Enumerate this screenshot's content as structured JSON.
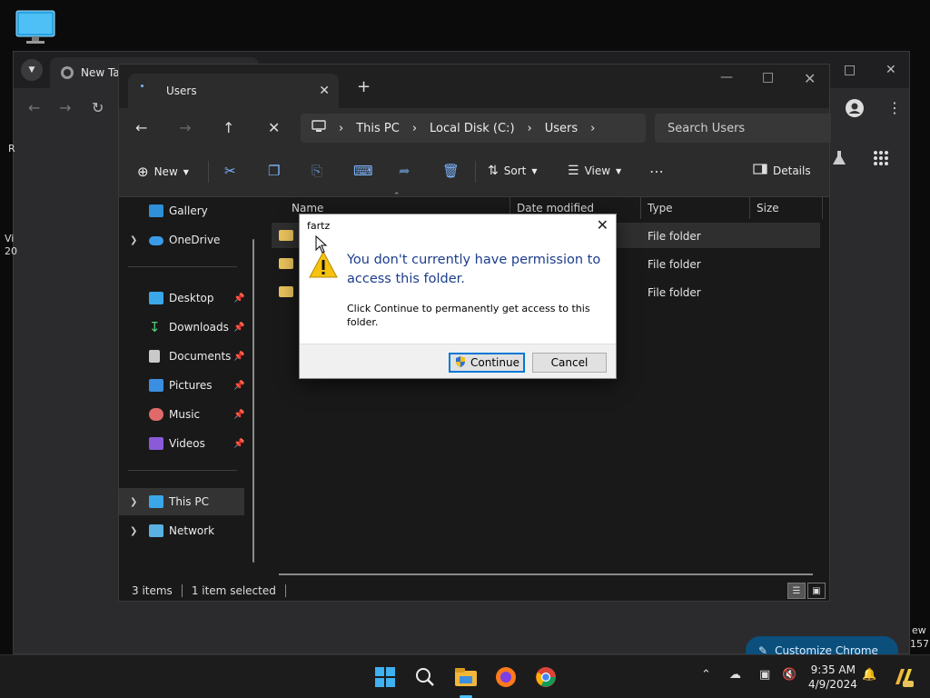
{
  "desktop": {
    "icon_name": "computer-monitor-icon"
  },
  "chrome": {
    "tab_title": "New Tab",
    "side_left_1": "R",
    "side_left_2": "Vi",
    "side_left_3": "20",
    "side_right_1": "ew",
    "side_right_2": "157",
    "customize_label": "Customize Chrome"
  },
  "explorer": {
    "tab_title": "Users",
    "breadcrumb": [
      "This PC",
      "Local Disk (C:)",
      "Users"
    ],
    "search_placeholder": "Search Users",
    "toolbar": {
      "new_label": "New",
      "sort_label": "Sort",
      "view_label": "View",
      "details_label": "Details"
    },
    "nav": {
      "gallery": "Gallery",
      "onedrive": "OneDrive",
      "desktop": "Desktop",
      "downloads": "Downloads",
      "documents": "Documents",
      "pictures": "Pictures",
      "music": "Music",
      "videos": "Videos",
      "thispc": "This PC",
      "network": "Network"
    },
    "columns": {
      "name": "Name",
      "date": "Date modified",
      "type": "Type",
      "size": "Size"
    },
    "rows": [
      {
        "type": "File folder"
      },
      {
        "type": "File folder"
      },
      {
        "type": "File folder"
      }
    ],
    "status": {
      "items": "3 items",
      "selected": "1 item selected"
    }
  },
  "dialog": {
    "title": "fartz",
    "heading": "You don't currently have permission to access this folder.",
    "body": "Click Continue to permanently get access to this folder.",
    "continue_label": "Continue",
    "cancel_label": "Cancel"
  },
  "taskbar": {
    "time": "9:35 AM",
    "date": "4/9/2024"
  },
  "colors": {
    "accent": "#0078d7",
    "dialog_heading": "#1c3c8c",
    "folder": "#e9c25b"
  }
}
